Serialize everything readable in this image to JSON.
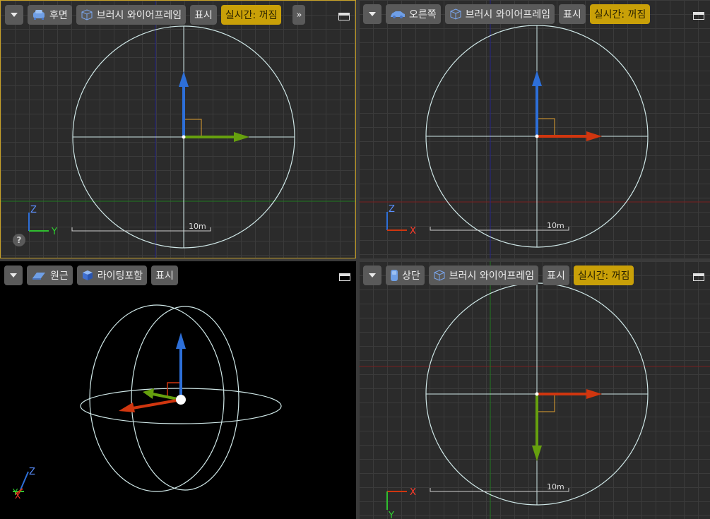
{
  "viewports": {
    "back": {
      "view_label": "후면",
      "shading_label": "브러시 와이어프레임",
      "show_label": "표시",
      "realtime_label": "실시간: 꺼짐",
      "more_label": "»",
      "scale_label": "10m",
      "axis_up": "Z",
      "axis_side": "Y",
      "help_label": "?"
    },
    "right": {
      "view_label": "오른쪽",
      "shading_label": "브러시 와이어프레임",
      "show_label": "표시",
      "realtime_label": "실시간: 꺼짐",
      "scale_label": "10m",
      "axis_up": "Z",
      "axis_side": "X"
    },
    "perspective": {
      "view_label": "원근",
      "shading_label": "라이팅포함",
      "show_label": "표시",
      "axis_up": "Z",
      "axis_x": "X",
      "axis_y": "Y"
    },
    "top": {
      "view_label": "상단",
      "shading_label": "브러시 와이어프레임",
      "show_label": "표시",
      "realtime_label": "실시간: 꺼짐",
      "scale_label": "10m",
      "axis_side": "X",
      "axis_down": "Y"
    }
  },
  "colors": {
    "active_border": "#c9a227",
    "realtime_badge": "#c9a008",
    "wire": "#cfe7e7",
    "axis_x": "#d0360f",
    "axis_y": "#66a00e",
    "axis_z": "#2d6fd8"
  },
  "icons": {
    "back": "car-back-icon",
    "right": "car-side-icon",
    "perspective": "perspective-plane-icon",
    "top": "phone-top-icon",
    "wireframe": "wireframe-cube-icon",
    "lit": "lit-cube-icon"
  }
}
